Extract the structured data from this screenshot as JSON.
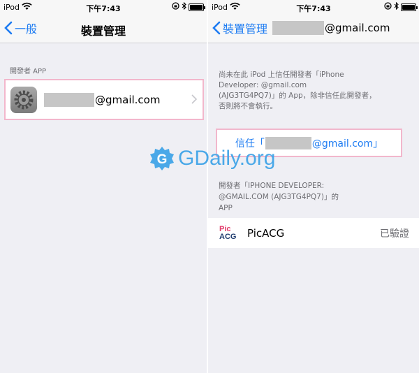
{
  "left_screen": {
    "status": {
      "carrier": "iPod",
      "time": "下午7:43"
    },
    "nav": {
      "back_label": "一般",
      "title": "裝置管理"
    },
    "section_header": "開發者 APP",
    "profile": {
      "email_suffix": "@gmail.com"
    }
  },
  "right_screen": {
    "status": {
      "carrier": "iPod",
      "time": "下午7:43"
    },
    "nav": {
      "back_label": "裝置管理",
      "title_email_suffix": "@gmail.com"
    },
    "description_lines": [
      "尚未在此 iPod 上信任開發者「iPhone",
      "Developer:                  @gmail.com",
      "(AJG3TG4PQ7)」的 App，除非信任此開發者，",
      "否則將不會執行。"
    ],
    "trust_button": {
      "prefix": "信任「",
      "suffix": "@gmail.com」"
    },
    "developer_lines": [
      "開發者「IPHONE DEVELOPER:",
      "               @GMAIL.COM (AJG3TG4PQ7)」的",
      "APP"
    ],
    "app": {
      "icon_line1": "Pic",
      "icon_line2": "ACG",
      "name": "PicACG",
      "status": "已驗證"
    }
  },
  "watermark": {
    "letter": "G",
    "text": "GDaily.org"
  },
  "colors": {
    "accent": "#1e7cf2",
    "highlight_border": "#f2b7cc",
    "background": "#efeff4",
    "watermark": "#4aa8e8"
  }
}
